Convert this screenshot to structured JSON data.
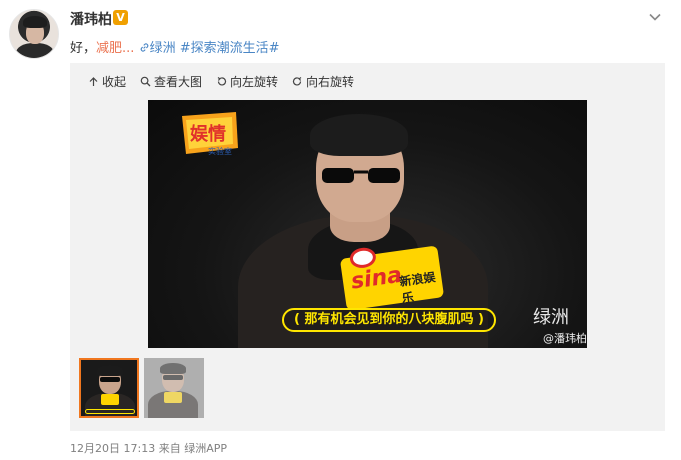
{
  "author": {
    "name": "潘玮柏",
    "badge": "V"
  },
  "post": {
    "text_prefix": "好，",
    "text_highlight": "减肥...",
    "location_link": "绿洲",
    "hashtag": "#探索潮流生活#"
  },
  "toolbar": {
    "collapse_label": "收起",
    "view_large_label": "查看大图",
    "rotate_left_label": "向左旋转",
    "rotate_right_label": "向右旋转"
  },
  "image": {
    "caption": "( 那有机会见到你的八块腹肌吗 )",
    "sina_word": "sina",
    "sina_sub": "新浪娱乐",
    "show_logo_text": "娱情",
    "show_logo_sub": "实验室",
    "oasis_mark": "绿洲",
    "watermark": "@潘玮柏"
  },
  "footer": {
    "date": "12月20日 17:13",
    "source_prefix": "来自",
    "source_name": "绿洲APP"
  },
  "colors": {
    "link_orange": "#eb7350",
    "hashtag_blue": "#4a86c5",
    "thumb_selected_border": "#f0771f",
    "caption_yellow": "#ffe600"
  }
}
